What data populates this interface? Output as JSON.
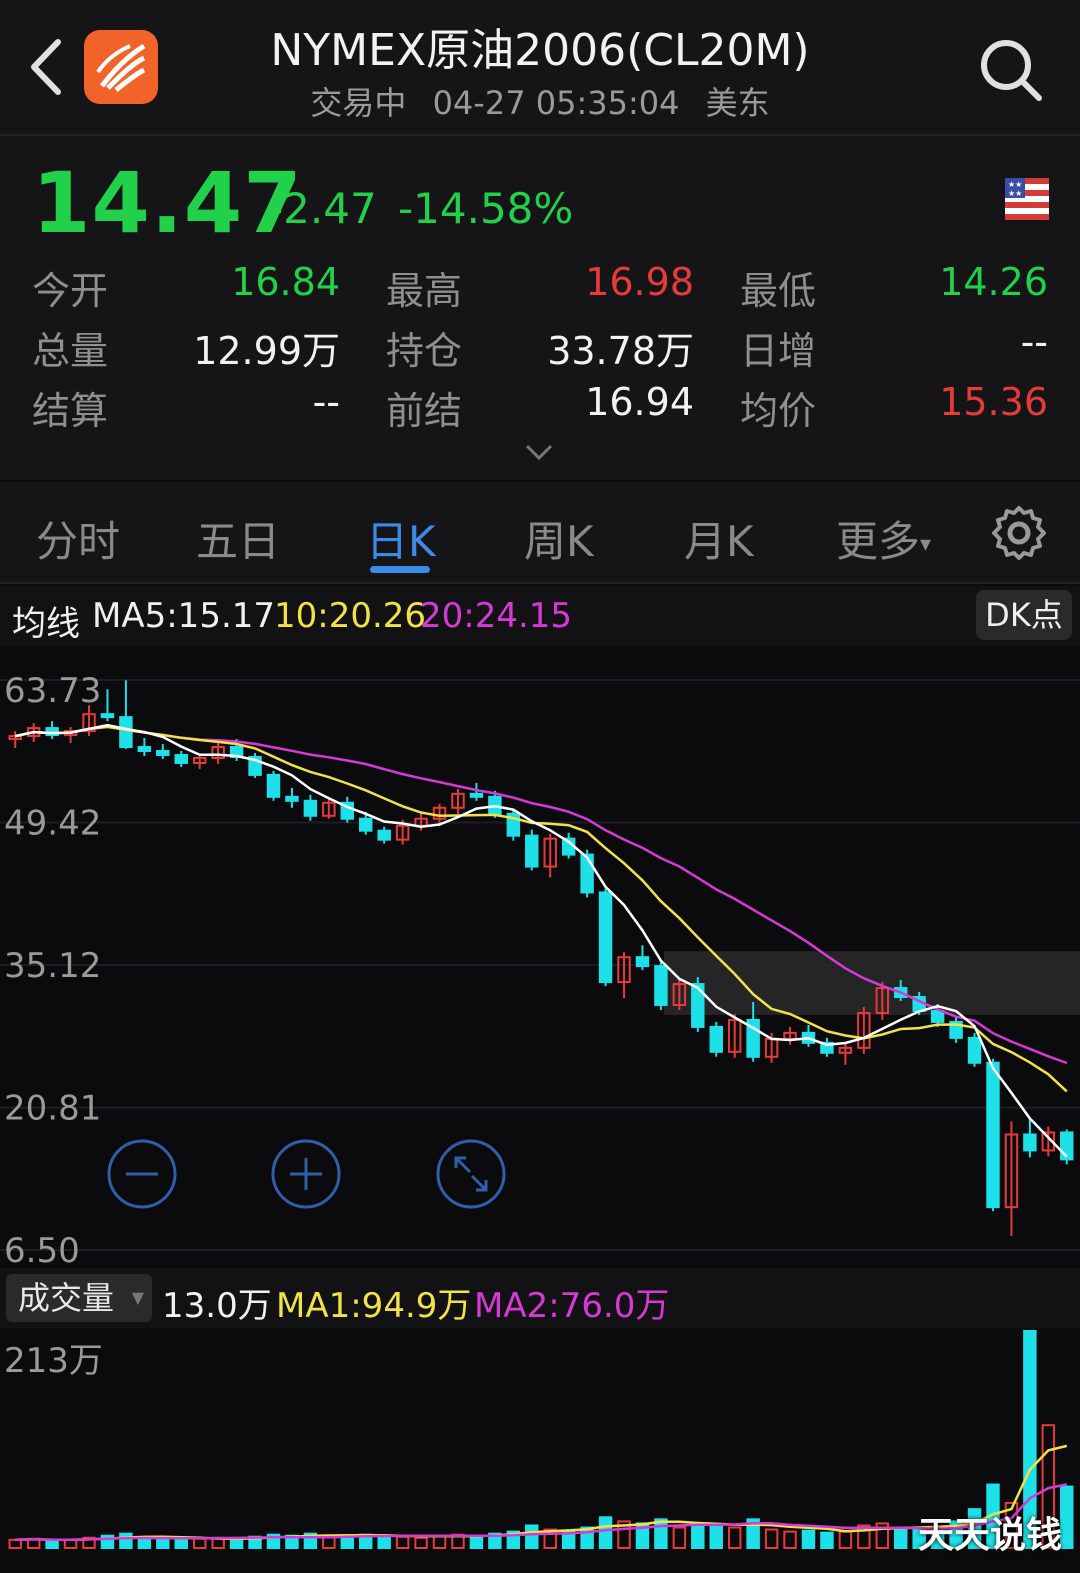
{
  "header": {
    "title": "NYMEX原油2006(CL20M)",
    "status": "交易中",
    "datetime": "04-27 05:35:04",
    "tz": "美东"
  },
  "quote": {
    "price": "14.47",
    "change": "-2.47",
    "change_pct": "-14.58%",
    "stats": [
      {
        "label": "今开",
        "value": "16.84",
        "color": "#22d14a"
      },
      {
        "label": "最高",
        "value": "16.98",
        "color": "#e63b3b"
      },
      {
        "label": "最低",
        "value": "14.26",
        "color": "#22d14a"
      },
      {
        "label": "总量",
        "value": "12.99万",
        "color": "#f2f2f2"
      },
      {
        "label": "持仓",
        "value": "33.78万",
        "color": "#f2f2f2"
      },
      {
        "label": "日增",
        "value": "--",
        "color": "#f2f2f2"
      },
      {
        "label": "结算",
        "value": "--",
        "color": "#f2f2f2"
      },
      {
        "label": "前结",
        "value": "16.94",
        "color": "#f2f2f2"
      },
      {
        "label": "均价",
        "value": "15.36",
        "color": "#e63b3b"
      }
    ]
  },
  "tabs": [
    "分时",
    "五日",
    "日K",
    "周K",
    "月K",
    "更多"
  ],
  "active_tab": "日K",
  "ma": {
    "label": "均线",
    "ma5": "MA5:15.17",
    "ma10": "10:20.26",
    "ma20": "20:24.15",
    "dk_button": "DK点"
  },
  "volume_header": {
    "selector": "成交量",
    "current": "13.0万",
    "ma1": "MA1:94.9万",
    "ma2": "MA2:76.0万"
  },
  "watermark": "天天说钱",
  "colors": {
    "up": "#e63b3b",
    "down": "#1ee0e8",
    "ma5": "#ffffff",
    "ma10": "#f2e24a",
    "ma20": "#d63ad6",
    "accent": "#3d8be6"
  },
  "chart_data": {
    "type": "candlestick",
    "y_ticks": [
      "63.73",
      "49.42",
      "35.12",
      "20.81",
      "6.50"
    ],
    "ylim": [
      6.5,
      63.73
    ],
    "volume_max_label": "213万",
    "volume_ylim": [
      0,
      213
    ],
    "candles": [
      [
        57.8,
        58.6,
        56.9,
        58.1
      ],
      [
        58.1,
        59.4,
        57.5,
        58.9
      ],
      [
        58.9,
        59.6,
        57.8,
        58.2
      ],
      [
        58.2,
        59.0,
        57.4,
        58.6
      ],
      [
        58.6,
        61.2,
        58.1,
        60.3
      ],
      [
        60.3,
        62.8,
        59.6,
        60.0
      ],
      [
        60.0,
        63.7,
        56.8,
        57.0
      ],
      [
        57.0,
        57.9,
        56.1,
        56.6
      ],
      [
        56.6,
        57.3,
        55.8,
        56.2
      ],
      [
        56.2,
        56.6,
        55.0,
        55.4
      ],
      [
        55.4,
        56.3,
        54.8,
        55.9
      ],
      [
        55.9,
        57.4,
        55.3,
        57.0
      ],
      [
        57.0,
        57.8,
        55.6,
        56.0
      ],
      [
        56.0,
        56.4,
        53.9,
        54.2
      ],
      [
        54.2,
        54.6,
        51.6,
        52.0
      ],
      [
        52.0,
        52.9,
        50.9,
        51.6
      ],
      [
        51.6,
        52.2,
        49.6,
        50.1
      ],
      [
        50.1,
        51.9,
        49.8,
        51.4
      ],
      [
        51.4,
        52.0,
        49.4,
        49.8
      ],
      [
        49.8,
        50.5,
        48.2,
        48.6
      ],
      [
        48.6,
        49.0,
        47.3,
        47.7
      ],
      [
        47.7,
        49.7,
        47.2,
        49.1
      ],
      [
        49.1,
        50.4,
        48.6,
        49.8
      ],
      [
        49.8,
        51.3,
        49.1,
        50.9
      ],
      [
        50.9,
        52.8,
        50.3,
        52.3
      ],
      [
        52.3,
        53.4,
        51.6,
        52.0
      ],
      [
        52.0,
        52.6,
        49.9,
        50.3
      ],
      [
        50.3,
        50.8,
        47.6,
        48.1
      ],
      [
        48.1,
        48.7,
        44.6,
        45.0
      ],
      [
        45.0,
        48.3,
        43.9,
        47.8
      ],
      [
        47.8,
        48.4,
        45.8,
        46.2
      ],
      [
        46.2,
        46.7,
        41.9,
        42.4
      ],
      [
        42.4,
        42.8,
        33.0,
        33.4
      ],
      [
        33.4,
        36.4,
        31.8,
        35.9
      ],
      [
        35.9,
        37.1,
        34.6,
        35.0
      ],
      [
        35.0,
        35.6,
        30.6,
        31.1
      ],
      [
        31.1,
        33.8,
        30.6,
        33.2
      ],
      [
        33.2,
        33.9,
        28.4,
        28.9
      ],
      [
        28.9,
        29.4,
        25.9,
        26.4
      ],
      [
        26.4,
        30.2,
        25.8,
        29.6
      ],
      [
        29.6,
        31.4,
        25.4,
        25.9
      ],
      [
        25.9,
        28.3,
        25.3,
        27.7
      ],
      [
        27.7,
        28.9,
        27.1,
        28.3
      ],
      [
        28.3,
        29.1,
        26.9,
        27.3
      ],
      [
        27.3,
        27.8,
        25.9,
        26.3
      ],
      [
        26.3,
        27.2,
        25.1,
        26.8
      ],
      [
        26.8,
        30.9,
        26.2,
        30.3
      ],
      [
        30.3,
        33.4,
        29.6,
        32.8
      ],
      [
        32.8,
        33.6,
        31.5,
        31.9
      ],
      [
        31.9,
        32.4,
        30.1,
        30.5
      ],
      [
        30.5,
        31.2,
        28.9,
        29.4
      ],
      [
        29.4,
        29.9,
        27.3,
        27.8
      ],
      [
        27.8,
        28.3,
        24.9,
        25.3
      ],
      [
        25.3,
        25.7,
        10.4,
        10.8
      ],
      [
        10.8,
        19.4,
        7.9,
        18.1
      ],
      [
        18.1,
        19.6,
        15.8,
        16.5
      ],
      [
        16.5,
        18.9,
        15.9,
        18.3
      ],
      [
        18.3,
        18.6,
        15.1,
        15.6
      ]
    ],
    "volumes": [
      8,
      9,
      7,
      8,
      10,
      12,
      14,
      10,
      9,
      8,
      9,
      10,
      9,
      11,
      13,
      12,
      14,
      11,
      12,
      13,
      12,
      11,
      10,
      12,
      13,
      12,
      14,
      16,
      22,
      18,
      16,
      20,
      30,
      26,
      24,
      28,
      20,
      24,
      22,
      20,
      28,
      18,
      16,
      17,
      15,
      16,
      22,
      24,
      20,
      18,
      20,
      26,
      38,
      62,
      44,
      213,
      120,
      60
    ]
  }
}
